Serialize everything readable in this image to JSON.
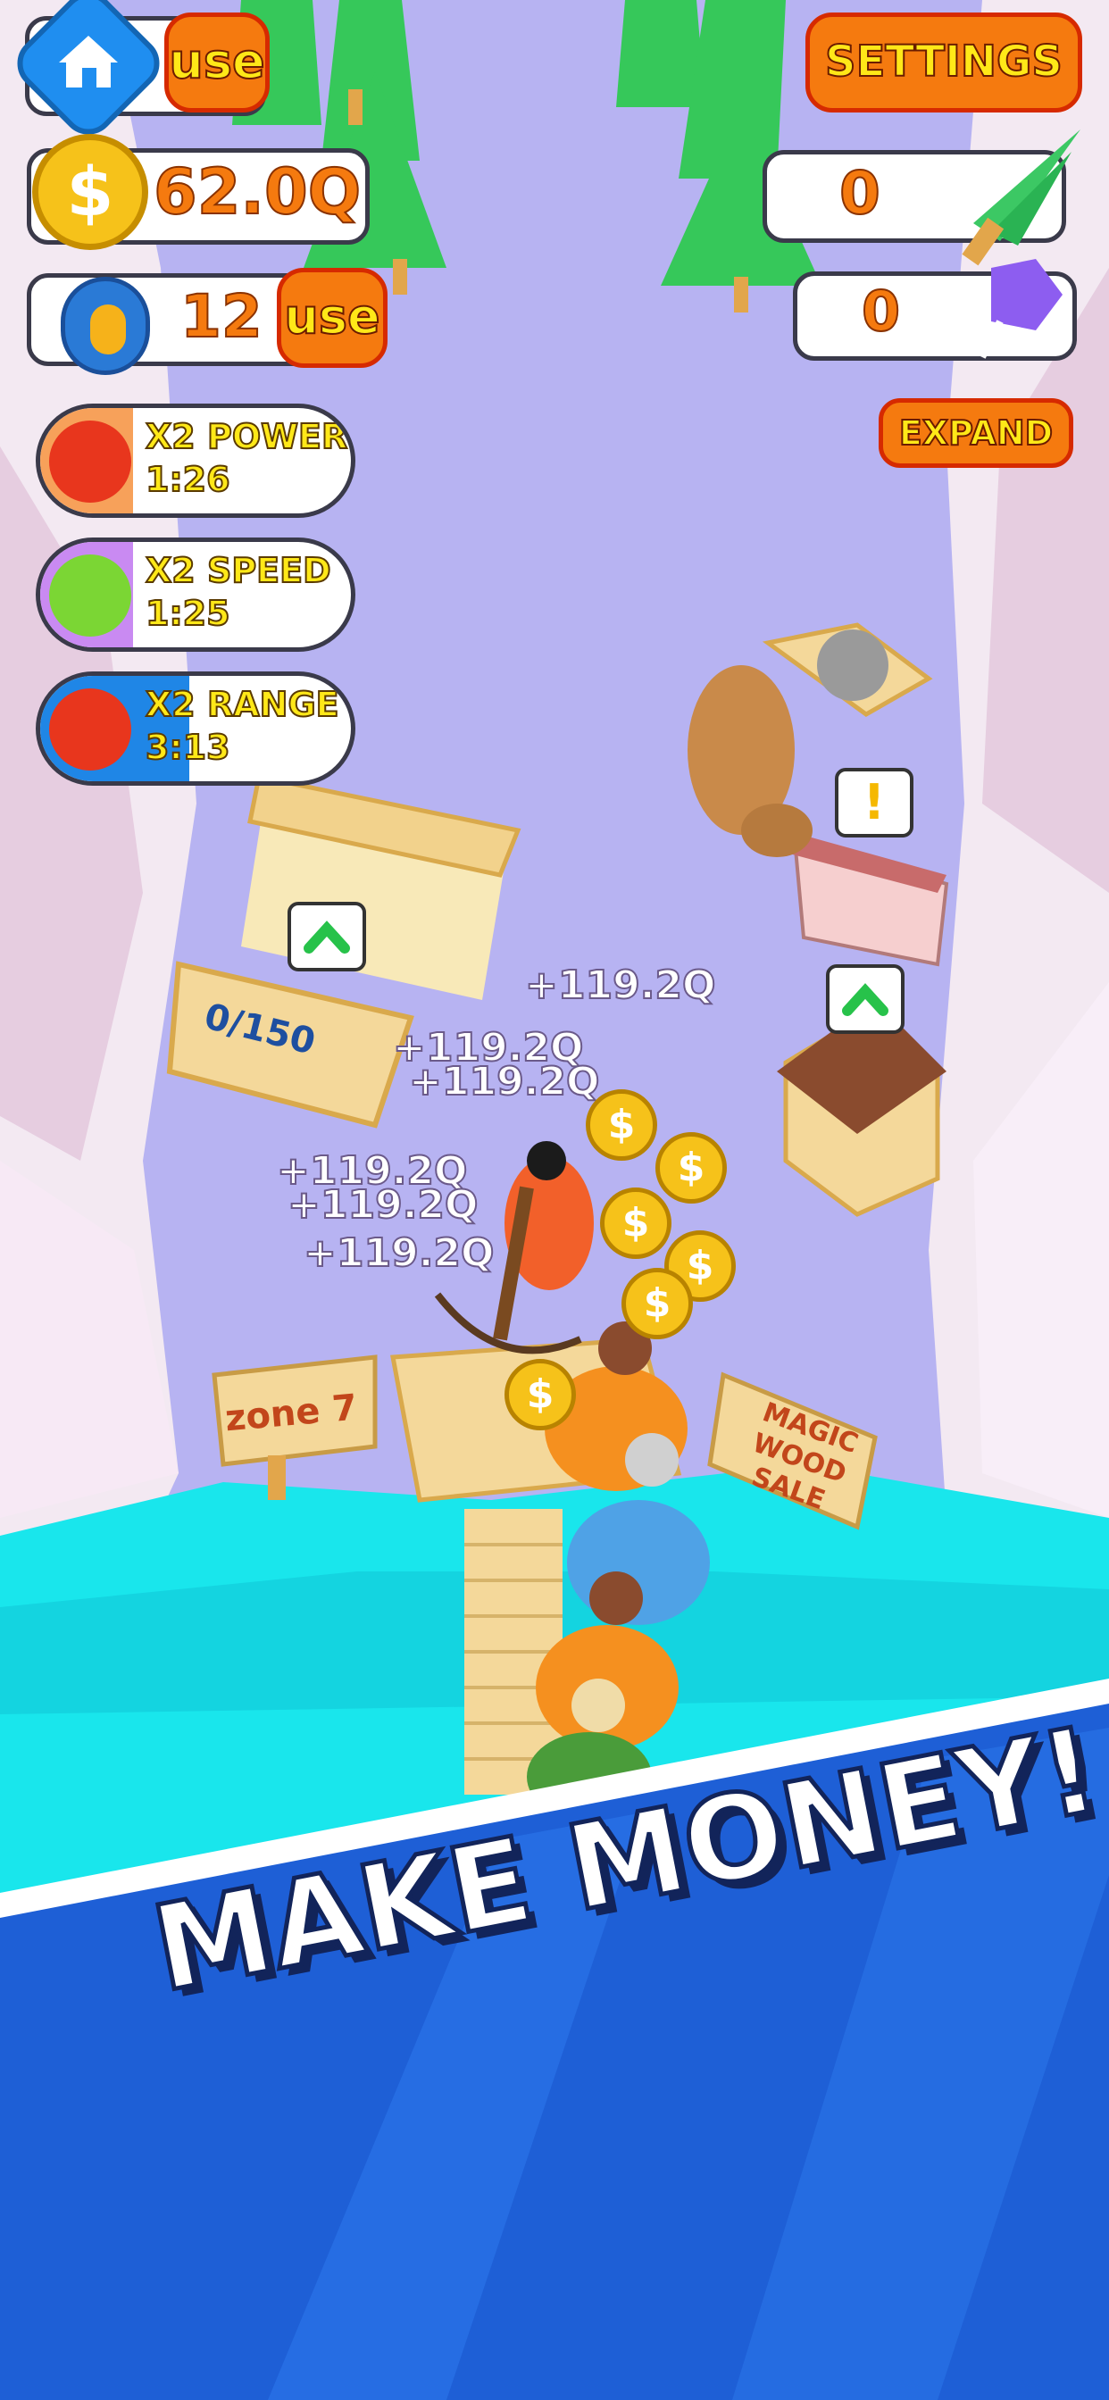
{
  "hud": {
    "home_use_label": "use",
    "settings_label": "SETTINGS",
    "coins_value": "62.0Q",
    "seeds_value": "12",
    "seeds_use_label": "use",
    "wood_value": "0",
    "purple_value": "0",
    "expand_label": "EXPAND"
  },
  "boosts": [
    {
      "label": "X2 POWER",
      "timer": "1:26",
      "icon": "apple-icon",
      "color": "#f7a15a",
      "progress": 0.3
    },
    {
      "label": "X2 SPEED",
      "timer": "1:25",
      "icon": "leaf-icon",
      "color": "#c98af2",
      "progress": 0.3
    },
    {
      "label": "X2 RANGE",
      "timer": "3:13",
      "icon": "mushroom-icon",
      "color": "#1f86e6",
      "progress": 0.48
    }
  ],
  "world": {
    "storage_count": "0/150",
    "zone_sign": "zone 7",
    "shop_sign": "MAGIC WOOD SALE",
    "alert_symbol": "!",
    "earn_popups": [
      "+119.2Q",
      "+119.2Q",
      "+119.2Q",
      "+119.2Q",
      "+119.2Q",
      "+119.2Q"
    ]
  },
  "banner": {
    "headline": "MAKE MONEY!"
  },
  "colors": {
    "accent_orange": "#f57a0f",
    "text_yellow": "#ffe818",
    "banner_blue": "#1e5fd6",
    "water": "#19e6ec",
    "ground": "#b7b3f2"
  }
}
